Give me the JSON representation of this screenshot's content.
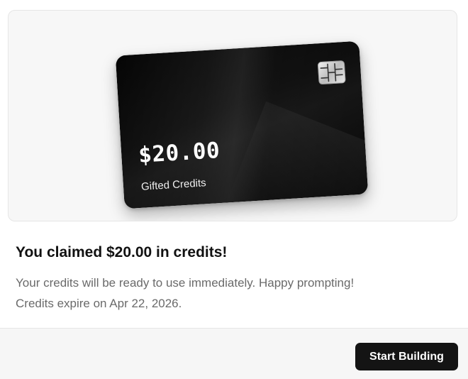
{
  "card": {
    "amount": "$20.00",
    "label": "Gifted Credits"
  },
  "message": {
    "title": "You claimed $20.00 in credits!",
    "line1": "Your credits will be ready to use immediately. Happy prompting!",
    "line2": "Credits expire on Apr 22, 2026."
  },
  "footer": {
    "button_label": "Start Building"
  },
  "colors": {
    "button_bg": "#141414",
    "card_bg": "#0a0a0a",
    "muted_text": "#6a6a6a"
  }
}
